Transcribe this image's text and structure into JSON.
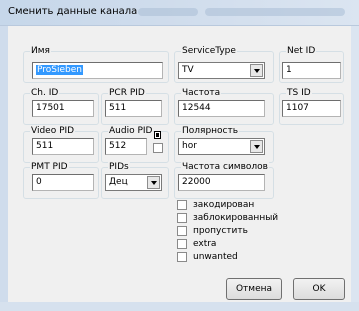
{
  "window": {
    "title": "Сменить данные канала"
  },
  "fields": {
    "name": {
      "caption": "Имя",
      "value": "ProSieben"
    },
    "service_type": {
      "caption": "ServiceType",
      "value": "TV"
    },
    "net_id": {
      "caption": "Net ID",
      "value": "1"
    },
    "ch_id": {
      "caption": "Ch. ID",
      "value": "17501"
    },
    "pcr_pid": {
      "caption": "PCR PID",
      "value": "511"
    },
    "frequency": {
      "caption": "Частота",
      "value": "12544"
    },
    "ts_id": {
      "caption": "TS ID",
      "value": "1107"
    },
    "video_pid": {
      "caption": "Video PID",
      "value": "511"
    },
    "audio_pid": {
      "caption": "Audio PID",
      "value": "512"
    },
    "polarity": {
      "caption": "Полярность",
      "value": "hor"
    },
    "pmt_pid": {
      "caption": "PMT PID",
      "value": "0"
    },
    "pids": {
      "caption": "PIDs",
      "value": "Дец"
    },
    "symbol_rate": {
      "caption": "Частота символов",
      "value": "22000"
    }
  },
  "checkboxes": [
    {
      "label": "закодирован",
      "checked": false
    },
    {
      "label": "заблокированный",
      "checked": false
    },
    {
      "label": "пропустить",
      "checked": false
    },
    {
      "label": "extra",
      "checked": false
    },
    {
      "label": "unwanted",
      "checked": false
    }
  ],
  "buttons": {
    "cancel": "Отмена",
    "ok": "OK"
  }
}
